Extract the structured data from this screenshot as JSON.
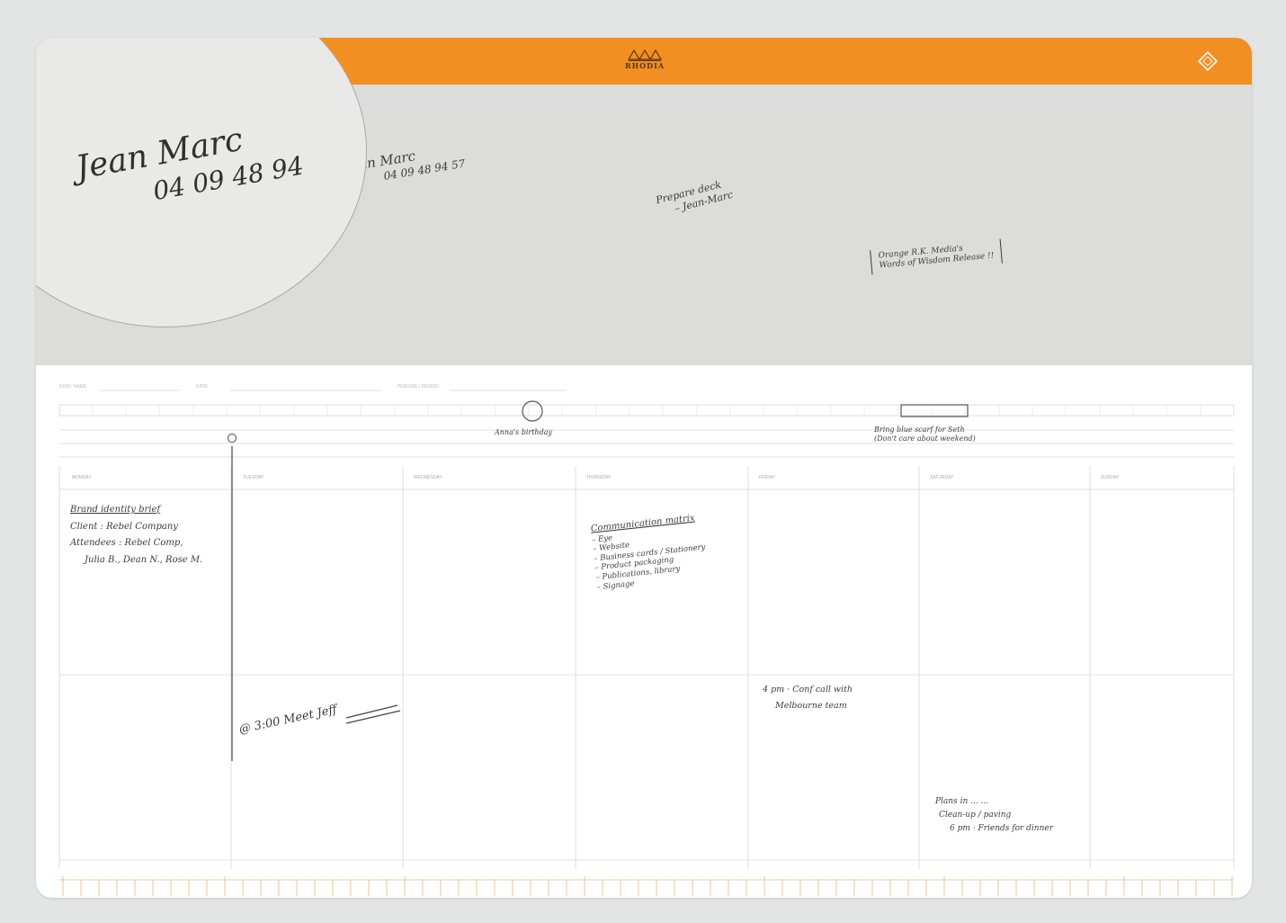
{
  "brand": {
    "name": "RHODIA",
    "color_orange": "#f18f22",
    "color_notes_bg": "#dcdcdb",
    "color_page_bg": "#e3e4e4",
    "color_ink": "#3b3b3b"
  },
  "header_fields": {
    "field_1": "NOM / NAME",
    "field_2": "DATE",
    "field_3": "PERIODE / PERIOD"
  },
  "handwritten_notes": {
    "magnified_signature_line1": "Jean Marc",
    "magnified_signature_line2": "04 09 48 94",
    "signature_line1": "Jean Marc",
    "signature_line2": "04 09 48 94 57",
    "prepare_note_line1": "Prepare deck",
    "prepare_note_line2": "– Jean-Marc",
    "bracket_note_line1": "Orange R.K. Media's",
    "bracket_note_line2": "Words of Wisdom Release !!",
    "birthday_note": "Anna's birthday",
    "reminder_line1": "Bring blue scarf for Seth",
    "reminder_line2": "(Don't care about weekend)",
    "brand_identity_title": "Brand identity brief",
    "brand_client": "Client : Rebel Company",
    "brand_attendees": "Attendees : Rebel Comp,",
    "brand_attendees_2": "Julia B., Dean N., Rose M.",
    "meeting_note": "@ 3:00 Meet Jeff",
    "communication_title": "Communication matrix",
    "communication_item_1": "– Eye",
    "communication_item_2": "– Website",
    "communication_item_3": "– Business cards / Stationery",
    "communication_item_4": "– Product packaging",
    "communication_item_5": "– Publications, library",
    "communication_item_6": "– Signage",
    "conf_call_line1": "4 pm · Conf call with",
    "conf_call_line2": "Melbourne team",
    "plans_line1": "Plans in ... ...",
    "plans_line2": "Clean-up / paving",
    "plans_line3": "6 pm · Friends for dinner"
  },
  "day_columns": [
    "MONDAY",
    "TUESDAY",
    "WEDNESDAY",
    "THURSDAY",
    "FRIDAY",
    "SATURDAY",
    "SUNDAY"
  ],
  "icons": {
    "corner_badge": "diamond-badge-icon",
    "logo": "rhodia-fir-trees-logo"
  }
}
